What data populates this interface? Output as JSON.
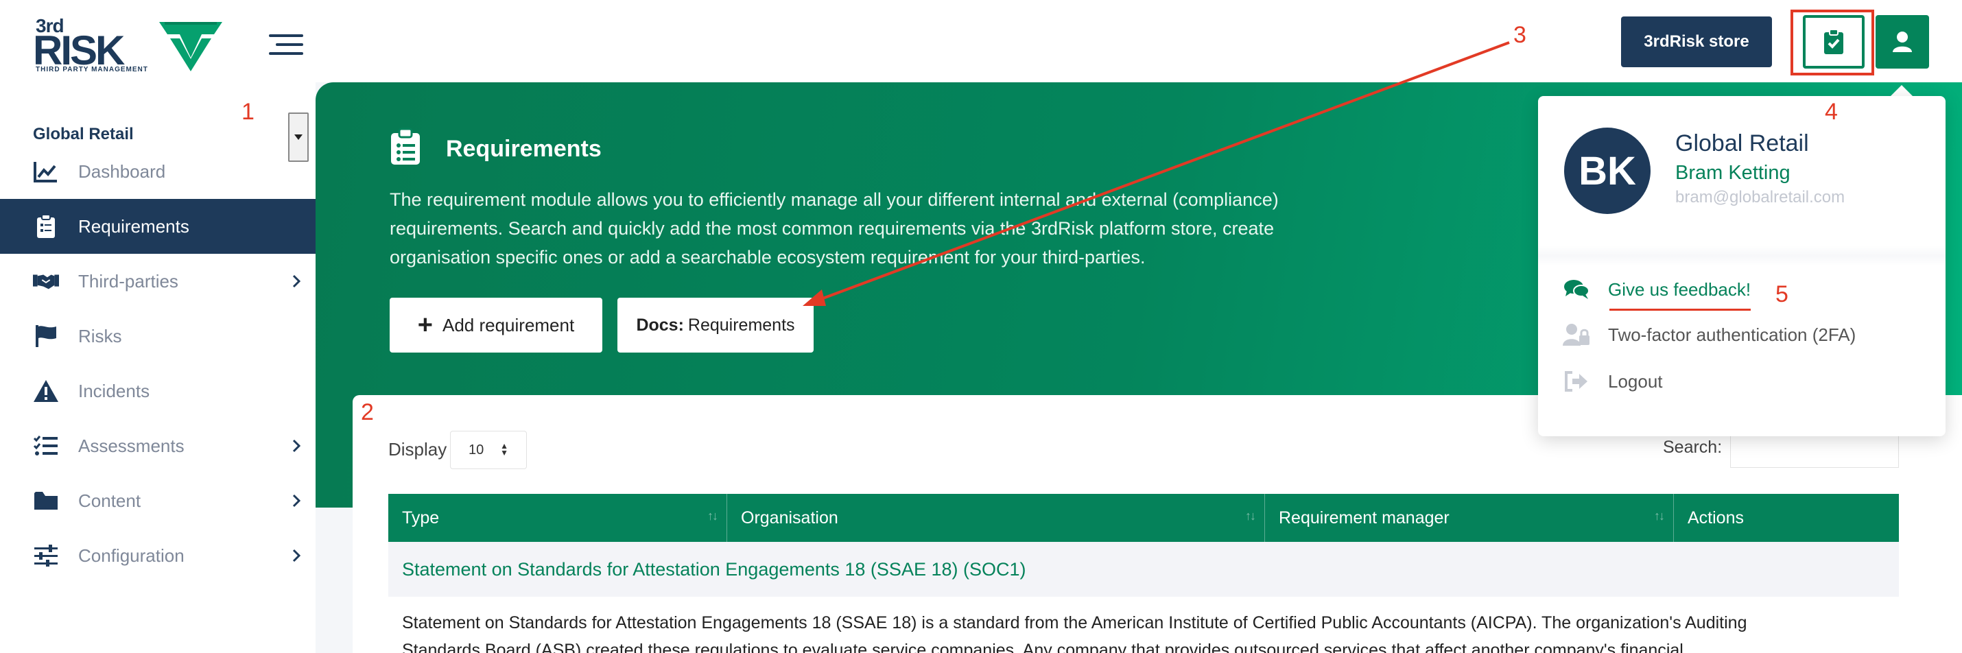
{
  "header": {
    "logo_top": "3rd",
    "logo_main": "RISK",
    "logo_sub": "THIRD PARTY MANAGEMENT",
    "store_button": "3rdRisk store"
  },
  "sidebar": {
    "org_selector": "Global Retail",
    "items": [
      {
        "label": "Dashboard",
        "icon": "chart-line-icon",
        "active": false,
        "has_submenu": false
      },
      {
        "label": "Requirements",
        "icon": "clipboard-list-icon",
        "active": true,
        "has_submenu": false
      },
      {
        "label": "Third-parties",
        "icon": "handshake-icon",
        "active": false,
        "has_submenu": true
      },
      {
        "label": "Risks",
        "icon": "flag-icon",
        "active": false,
        "has_submenu": false
      },
      {
        "label": "Incidents",
        "icon": "warning-icon",
        "active": false,
        "has_submenu": false
      },
      {
        "label": "Assessments",
        "icon": "tasks-icon",
        "active": false,
        "has_submenu": true
      },
      {
        "label": "Content",
        "icon": "folder-icon",
        "active": false,
        "has_submenu": true
      },
      {
        "label": "Configuration",
        "icon": "sliders-icon",
        "active": false,
        "has_submenu": true
      }
    ]
  },
  "hero": {
    "title": "Requirements",
    "description_lines": [
      "The requirement module allows you to efficiently manage all your different internal and external (compliance)",
      "requirements. Search and quickly add the most common requirements via the 3rdRisk platform store, create",
      "organisation specific ones or add a searchable ecosystem requirement for your third-parties."
    ],
    "add_button": "Add requirement",
    "docs_button_bold": "Docs:",
    "docs_button_text": "Requirements"
  },
  "table": {
    "display_label": "Display",
    "display_value": "10",
    "search_label": "Search:",
    "search_value": "",
    "columns": [
      "Type",
      "Organisation",
      "Requirement manager",
      "Actions"
    ],
    "rows": [
      {
        "title": "Statement on Standards for Attestation Engagements 18 (SSAE 18) (SOC1)",
        "description_lines": [
          "Statement on Standards for Attestation Engagements 18 (SSAE 18) is a standard from the American Institute of Certified Public Accountants (AICPA). The organization's Auditing",
          "Standards Board (ASB) created these regulations to evaluate service companies. Any company that provides outsourced services that affect another company's financial"
        ]
      }
    ]
  },
  "user_menu": {
    "avatar_initials": "BK",
    "organisation": "Global Retail",
    "user_name": "Bram Ketting",
    "email": "bram@globalretail.com",
    "items": [
      {
        "label": "Give us feedback!",
        "icon": "comments-icon"
      },
      {
        "label": "Two-factor authentication (2FA)",
        "icon": "user-lock-icon"
      },
      {
        "label": "Logout",
        "icon": "sign-out-icon"
      }
    ]
  },
  "annotations": [
    "1",
    "2",
    "3",
    "4",
    "5"
  ],
  "colors": {
    "brand_navy": "#1e3a5a",
    "brand_green": "#05825a",
    "annotation_red": "#e23a25"
  }
}
